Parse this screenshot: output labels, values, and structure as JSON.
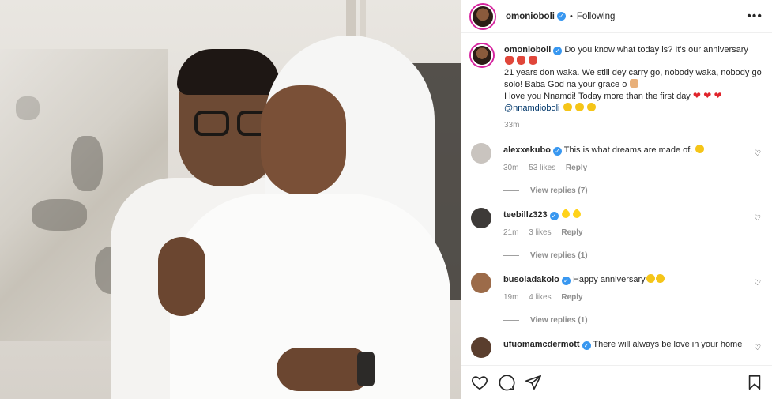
{
  "header": {
    "username": "omonioboli",
    "separator": "•",
    "follow_status": "Following",
    "more_label": "•••"
  },
  "caption": {
    "username": "omonioboli",
    "lines": [
      "Do you know what today is? It's our anniversary",
      "21 years don waka. We still dey carry go, nobody waka, nobody go solo! Baba God na your grace o",
      "I love you Nnamdi! Today more than the first day",
      "@nnamdioboli"
    ],
    "time": "33m"
  },
  "comments": [
    {
      "username": "alexxekubo",
      "text": "This is what dreams are made of.",
      "time": "30m",
      "likes": "53 likes",
      "reply": "Reply",
      "view_replies": "View replies (7)",
      "avatar_color": "#c9c4bf"
    },
    {
      "username": "teebillz323",
      "text": "",
      "time": "21m",
      "likes": "3 likes",
      "reply": "Reply",
      "view_replies": "View replies (1)",
      "avatar_color": "#3d3a38"
    },
    {
      "username": "busoladakolo",
      "text": "Happy anniversary",
      "time": "19m",
      "likes": "4 likes",
      "reply": "Reply",
      "view_replies": "View replies (1)",
      "avatar_color": "#9c6b49"
    },
    {
      "username": "ufuomamcdermott",
      "text": "There will always be love in your home",
      "avatar_color": "#5a3e2e"
    }
  ],
  "icons": {
    "like": "heart-icon",
    "comment": "comment-icon",
    "share": "share-icon",
    "save": "bookmark-icon",
    "verified": "verified-badge-icon"
  },
  "colors": {
    "verified": "#3897f0",
    "story_ring": "#d6249f",
    "meta_text": "#8e8e8e"
  }
}
